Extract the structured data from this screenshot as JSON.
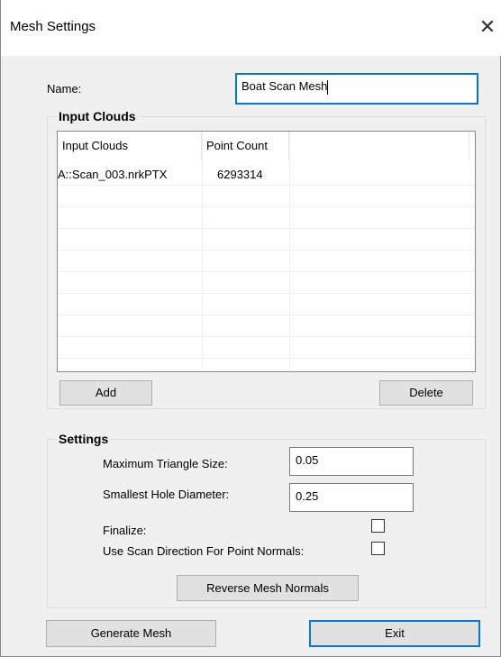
{
  "window": {
    "title": "Mesh Settings",
    "close_glyph": "✕"
  },
  "name_field": {
    "label": "Name:",
    "value": "Boat Scan Mesh"
  },
  "input_clouds": {
    "group_title": "Input Clouds",
    "columns": [
      "Input Clouds",
      "Point Count"
    ],
    "rows": [
      {
        "cloud": "A::Scan_003.nrkPTX",
        "count": "6293314"
      }
    ],
    "add_label": "Add",
    "delete_label": "Delete"
  },
  "settings": {
    "group_title": "Settings",
    "max_triangle_label": "Maximum Triangle Size:",
    "max_triangle_value": "0.05",
    "smallest_hole_label": "Smallest Hole Diameter:",
    "smallest_hole_value": "0.25",
    "finalize_label": "Finalize:",
    "finalize_checked": false,
    "scan_direction_label": "Use Scan Direction For Point Normals:",
    "scan_direction_checked": false,
    "reverse_normals_label": "Reverse Mesh Normals"
  },
  "footer": {
    "generate_label": "Generate Mesh",
    "exit_label": "Exit"
  },
  "colors": {
    "focus_accent": "#0078d7",
    "dialog_bg": "#f0f0f0"
  },
  "icons": {
    "close": "close-icon"
  }
}
